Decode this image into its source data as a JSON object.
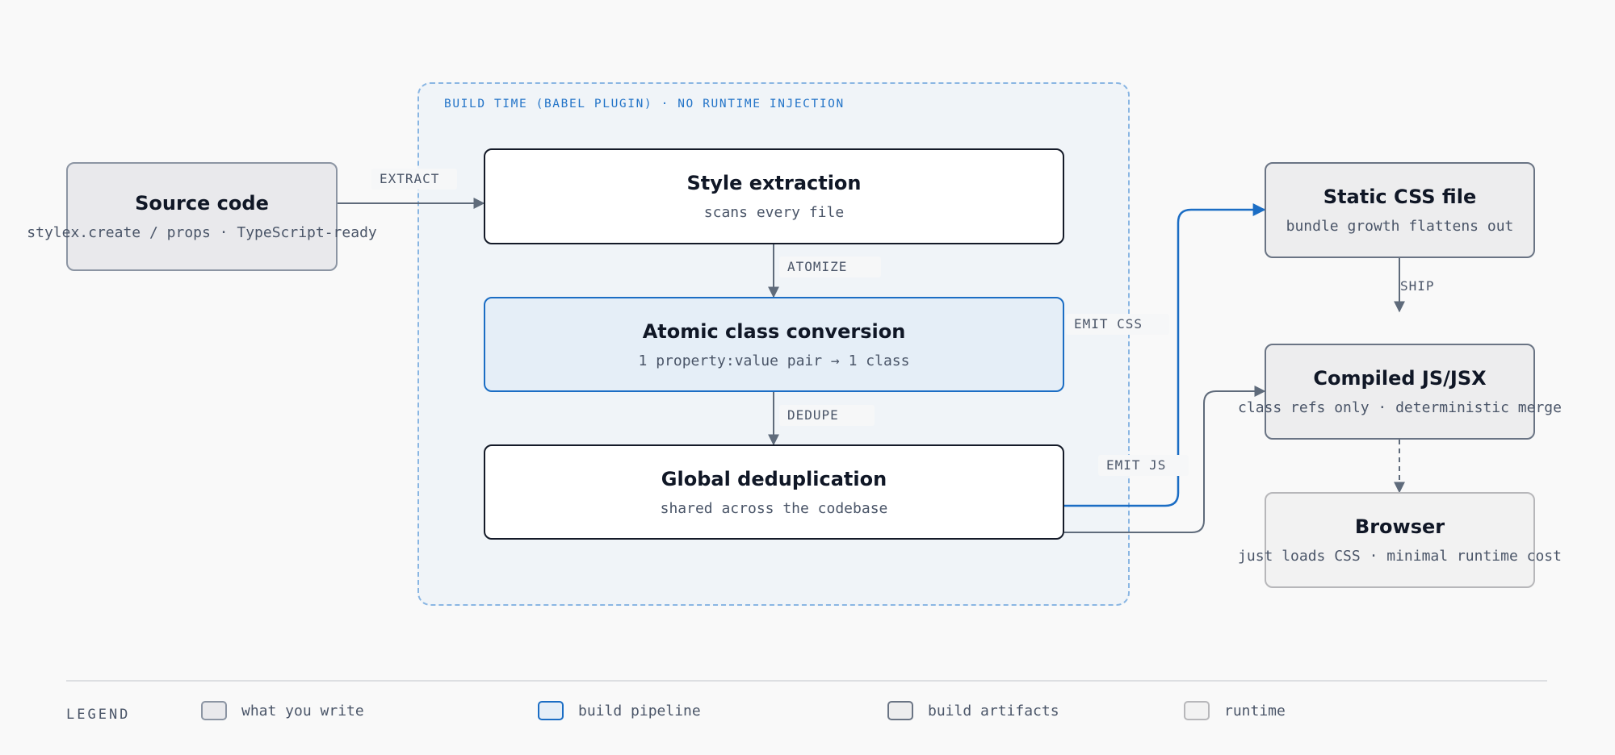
{
  "group": {
    "title": "BUILD TIME (BABEL PLUGIN) · NO RUNTIME INJECTION"
  },
  "nodes": {
    "source": {
      "title": "Source code",
      "sub": "stylex.create / props · TypeScript-ready"
    },
    "extraction": {
      "title": "Style extraction",
      "sub": "scans every file"
    },
    "atomic": {
      "title": "Atomic class conversion",
      "sub": "1 property:value pair → 1 class"
    },
    "dedupe": {
      "title": "Global deduplication",
      "sub": "shared across the codebase"
    },
    "css": {
      "title": "Static CSS file",
      "sub": "bundle growth flattens out"
    },
    "js": {
      "title": "Compiled JS/JSX",
      "sub": "class refs only · deterministic merge"
    },
    "browser": {
      "title": "Browser",
      "sub": "just loads CSS · minimal runtime cost"
    }
  },
  "edges": {
    "extract": "EXTRACT",
    "atomize": "ATOMIZE",
    "dedupe": "DEDUPE",
    "emit_css": "EMIT CSS",
    "emit_js": "EMIT JS",
    "ship": "SHIP"
  },
  "legend": {
    "heading": "LEGEND",
    "items": [
      "what you write",
      "build pipeline",
      "build artifacts",
      "runtime"
    ]
  },
  "colors": {
    "accent_blue": "#1b6dc4",
    "edge_gray": "#5f6b7b",
    "group_border": "#8ab6e3",
    "group_fill": "#f0f4f8"
  }
}
